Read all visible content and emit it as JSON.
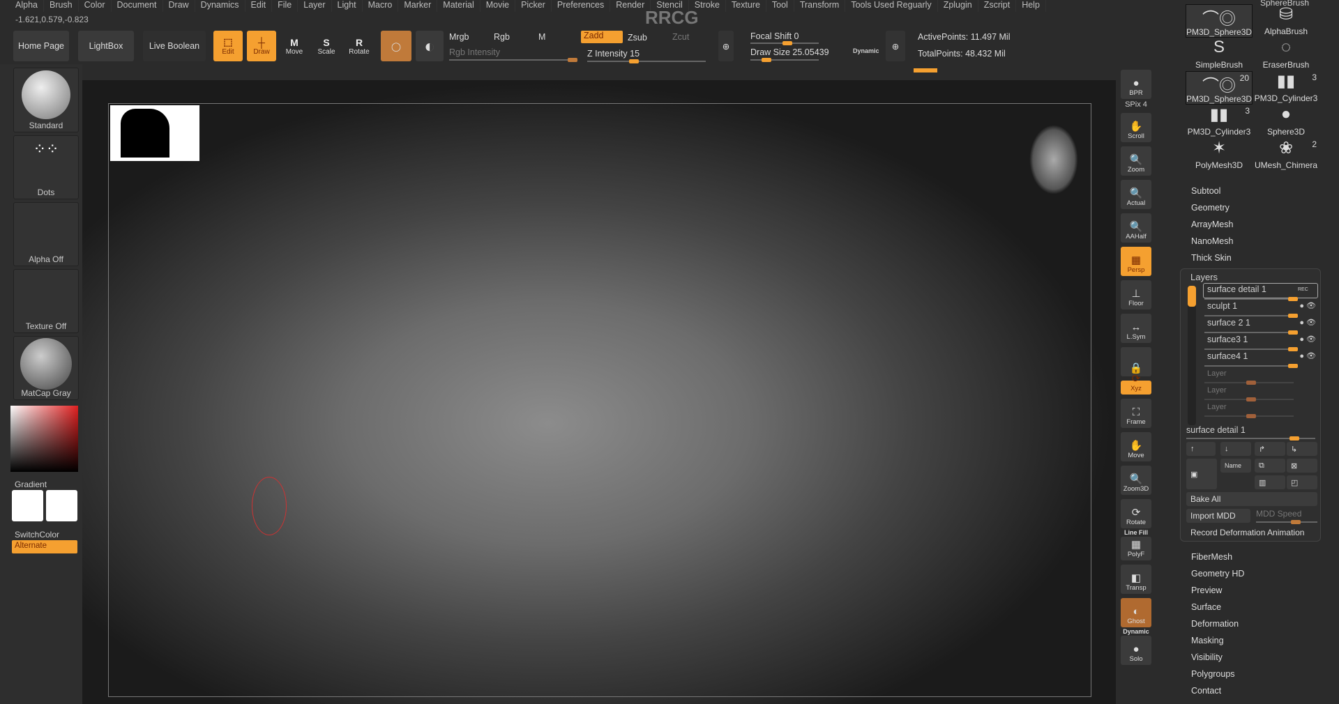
{
  "menu": [
    "Alpha",
    "Brush",
    "Color",
    "Document",
    "Draw",
    "Dynamics",
    "Edit",
    "File",
    "Layer",
    "Light",
    "Macro",
    "Marker",
    "Material",
    "Movie",
    "Picker",
    "Preferences",
    "Render",
    "Stencil",
    "Stroke",
    "Texture",
    "Tool",
    "Transform",
    "Tools Used Reguarly",
    "Zplugin",
    "Zscript",
    "Help"
  ],
  "coords": "-1.621,0.579,-0.823",
  "watermark": "RRCG",
  "toolbar": {
    "home": "Home Page",
    "lightbox": "LightBox",
    "live_boolean": "Live Boolean",
    "edit": "Edit",
    "draw": "Draw",
    "move": "Move",
    "scale": "Scale",
    "rotate": "Rotate",
    "mrgb": "Mrgb",
    "rgb": "Rgb",
    "m": "M",
    "rgb_intensity": "Rgb Intensity",
    "zadd": "Zadd",
    "zsub": "Zsub",
    "zcut": "Zcut",
    "z_intensity": "Z Intensity 15",
    "z_intensity_value": 15,
    "focal_shift": "Focal Shift 0",
    "focal_value": 0,
    "draw_size": "Draw Size 25.05439",
    "dynamic": "Dynamic",
    "active_points": "ActivePoints: 11.497 Mil",
    "total_points": "TotalPoints: 48.432 Mil"
  },
  "left": {
    "brush": "Standard",
    "stroke": "Dots",
    "alpha": "Alpha Off",
    "texture": "Texture Off",
    "material": "MatCap Gray",
    "gradient": "Gradient",
    "switch": "SwitchColor",
    "alternate": "Alternate"
  },
  "right_toolbar": [
    "BPR",
    "SPix 4",
    "Scroll",
    "Zoom",
    "Actual",
    "AAHalf",
    "Persp",
    "Floor",
    "L.Sym",
    "",
    "Xyz",
    "Frame",
    "Move",
    "Zoom3D",
    "Rotate",
    "PolyF",
    "Transp",
    "Ghost",
    "Solo"
  ],
  "right_toolbar_extra": {
    "linefill": "Line Fill",
    "dynamic": "Dynamic"
  },
  "tools": [
    {
      "name": "PM3D_Sphere3D",
      "count": ""
    },
    {
      "name": "AlphaBrush",
      "count": ""
    },
    {
      "name": "SimpleBrush",
      "count": ""
    },
    {
      "name": "EraserBrush",
      "count": ""
    },
    {
      "name": "PM3D_Sphere3D",
      "count": "20"
    },
    {
      "name": "PM3D_Cylinder3",
      "count": "3"
    },
    {
      "name": "PM3D_Cylinder3",
      "count": "3"
    },
    {
      "name": "Sphere3D",
      "count": ""
    },
    {
      "name": "PolyMesh3D",
      "count": ""
    },
    {
      "name": "UMesh_Chimera",
      "count": "2"
    }
  ],
  "tool_top": "SphereBrush",
  "menus_top": [
    "Subtool",
    "Geometry",
    "ArrayMesh",
    "NanoMesh",
    "Thick Skin"
  ],
  "layers": {
    "title": "Layers",
    "rec": "REC",
    "items": [
      "surface detail 1",
      "sculpt 1",
      "surface 2 1",
      "surface3 1",
      "surface4 1"
    ],
    "empty": [
      "Layer",
      "Layer",
      "Layer"
    ],
    "current": "surface detail 1",
    "name_btn": "Name",
    "bake_all": "Bake All",
    "import_mdd": "Import MDD",
    "mdd_speed": "MDD Speed",
    "record": "Record Deformation Animation"
  },
  "menus_bottom": [
    "FiberMesh",
    "Geometry HD",
    "Preview",
    "Surface",
    "Deformation",
    "Masking",
    "Visibility",
    "Polygroups",
    "Contact"
  ],
  "accent": "#f5a030"
}
